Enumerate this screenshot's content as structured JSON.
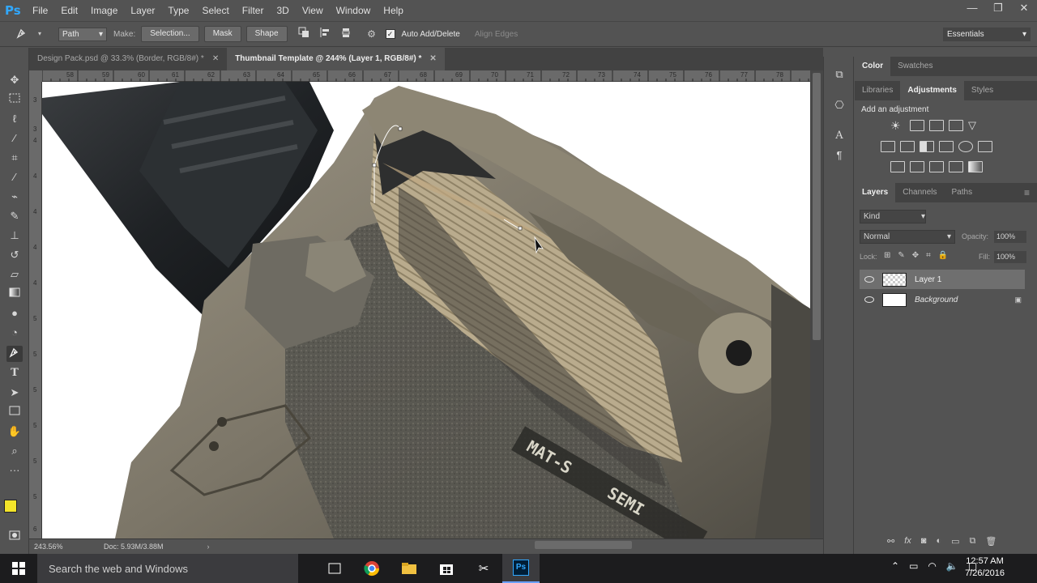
{
  "app": {
    "logo": "Ps",
    "menu": [
      "File",
      "Edit",
      "Image",
      "Layer",
      "Type",
      "Select",
      "Filter",
      "3D",
      "View",
      "Window",
      "Help"
    ],
    "window_controls": [
      "—",
      "❐",
      "✕"
    ]
  },
  "options_bar": {
    "mode": "Path",
    "make_label": "Make:",
    "selection_button": "Selection...",
    "mask_button": "Mask",
    "shape_button": "Shape",
    "auto_add_delete": "Auto Add/Delete",
    "align_edges": "Align Edges",
    "workspace": "Essentials"
  },
  "document_tabs": [
    {
      "label": "Design Pack.psd @ 33.3% (Border, RGB/8#) *",
      "active": false
    },
    {
      "label": "Thumbnail Template @ 244% (Layer 1, RGB/8#) *",
      "active": true
    }
  ],
  "ruler_top_labels": [
    "58",
    "59",
    "60",
    "61",
    "62",
    "63",
    "64",
    "65",
    "66",
    "67",
    "68",
    "69",
    "70",
    "71",
    "72",
    "73",
    "74",
    "75",
    "76",
    "77",
    "78"
  ],
  "ruler_left_labels": [
    "3",
    "3",
    "4",
    "4",
    "4",
    "4",
    "4",
    "5",
    "5",
    "5",
    "5",
    "5",
    "5",
    "6"
  ],
  "canvas_text": {
    "stamp_line1": "MAT-S",
    "stamp_line2": "SEMI"
  },
  "status": {
    "zoom": "243.56%",
    "doc": "Doc: 5.93M/3.88M"
  },
  "panels": {
    "color_tabs": [
      "Color",
      "Swatches"
    ],
    "adjust_tabs": [
      "Libraries",
      "Adjustments",
      "Styles"
    ],
    "add_adjustment": "Add an adjustment",
    "layers_tabs": [
      "Layers",
      "Channels",
      "Paths"
    ],
    "kind_filter": "Kind",
    "blend_mode": "Normal",
    "opacity_label": "Opacity:",
    "opacity_value": "100%",
    "lock_label": "Lock:",
    "fill_label": "Fill:",
    "fill_value": "100%",
    "layers": [
      {
        "name": "Layer 1",
        "selected": true
      },
      {
        "name": "Background",
        "selected": false,
        "locked": true
      }
    ]
  },
  "colors": {
    "foreground": "#f4e52a",
    "background": "#ffffff",
    "ps_blue": "#31a8ff"
  },
  "taskbar": {
    "search_placeholder": "Search the web and Windows",
    "time": "12:57 AM",
    "date": "7/26/2016"
  }
}
